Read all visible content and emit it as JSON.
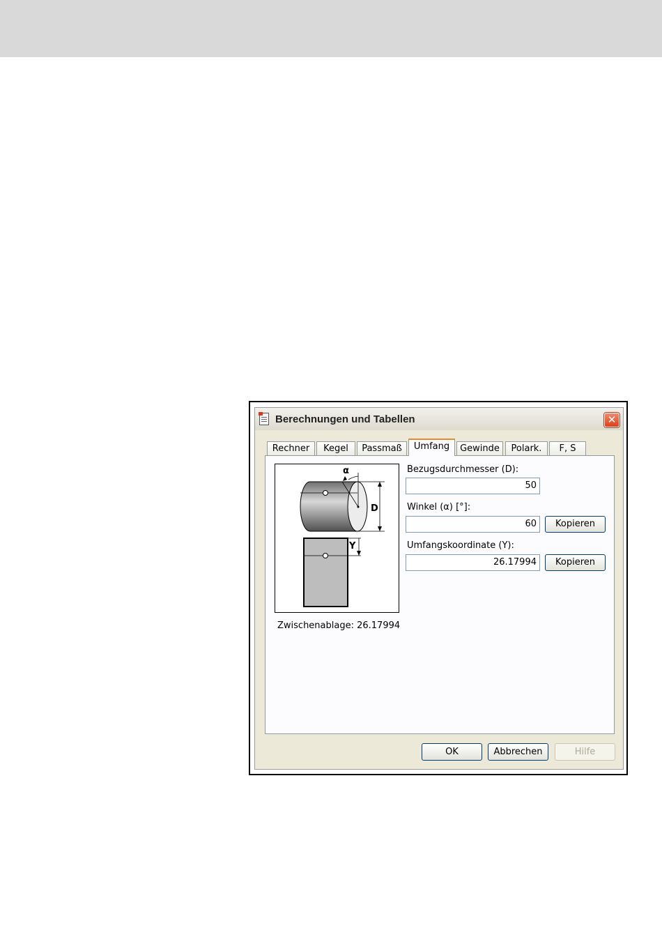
{
  "window": {
    "title": "Berechnungen und Tabellen",
    "close_glyph": "✕",
    "icon": "calculator-icon"
  },
  "tabs": [
    {
      "label": "Rechner"
    },
    {
      "label": "Kegel"
    },
    {
      "label": "Passmaß"
    },
    {
      "label": "Umfang",
      "active": true
    },
    {
      "label": "Gewinde"
    },
    {
      "label": "Polark."
    },
    {
      "label": "F, S"
    }
  ],
  "diagram": {
    "label_alpha": "α",
    "label_d": "D",
    "label_y": "Y"
  },
  "clipboard": {
    "text": "Zwischenablage: 26.17994"
  },
  "fields": {
    "diameter": {
      "label": "Bezugsdurchmesser (D):",
      "value": "50"
    },
    "angle": {
      "label": "Winkel (α) [°]:",
      "value": "60",
      "copy_label": "Kopieren"
    },
    "coordinate": {
      "label": "Umfangskoordinate (Y):",
      "value": "26.17994",
      "copy_label": "Kopieren"
    }
  },
  "buttons": {
    "ok": "OK",
    "cancel": "Abbrechen",
    "help": "Hilfe"
  },
  "colors": {
    "dialog_bg": "#ece9d8",
    "active_tab_accent": "#e68b2c",
    "close_button": "#d9401d"
  }
}
